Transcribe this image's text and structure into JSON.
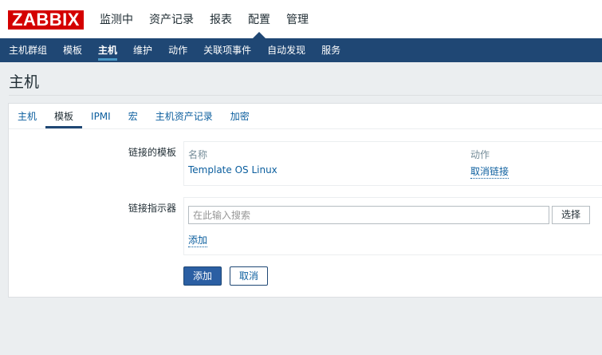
{
  "app": {
    "logo": "ZABBIX"
  },
  "main_nav": [
    {
      "label": "监测中"
    },
    {
      "label": "资产记录"
    },
    {
      "label": "报表"
    },
    {
      "label": "配置",
      "active": true
    },
    {
      "label": "管理"
    }
  ],
  "sub_nav": [
    {
      "label": "主机群组"
    },
    {
      "label": "模板"
    },
    {
      "label": "主机",
      "active": true
    },
    {
      "label": "维护"
    },
    {
      "label": "动作"
    },
    {
      "label": "关联项事件"
    },
    {
      "label": "自动发现"
    },
    {
      "label": "服务"
    }
  ],
  "page": {
    "title": "主机"
  },
  "tabs": [
    {
      "label": "主机"
    },
    {
      "label": "模板",
      "active": true
    },
    {
      "label": "IPMI"
    },
    {
      "label": "宏"
    },
    {
      "label": "主机资产记录"
    },
    {
      "label": "加密"
    }
  ],
  "linked_templates": {
    "label": "链接的模板",
    "columns": {
      "name": "名称",
      "action": "动作"
    },
    "rows": [
      {
        "name": "Template OS Linux",
        "action": "取消链接"
      }
    ]
  },
  "link_indicator": {
    "label": "链接指示器",
    "placeholder": "在此输入搜索",
    "select_label": "选择",
    "add_label": "添加"
  },
  "buttons": {
    "add": "添加",
    "cancel": "取消"
  },
  "colors": {
    "logo_bg": "#d40000",
    "nav_bar": "#1f4774",
    "link": "#0b5e9e",
    "primary_button": "#2b5fa3",
    "page_bg": "#ebeef0"
  }
}
